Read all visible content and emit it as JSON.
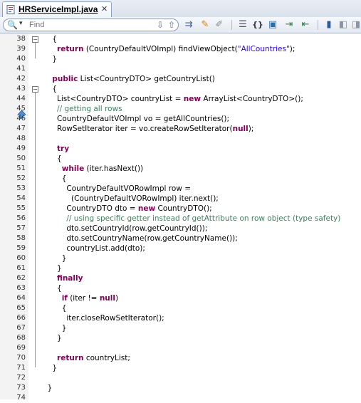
{
  "tab": {
    "title": "HRServiceImpl.java",
    "close": "✕"
  },
  "toolbar": {
    "find_placeholder": "Find",
    "icons": [
      "search-icon",
      "find-down-icon",
      "find-up-icon",
      "goto-icon",
      "highlight-icon",
      "clear-highlight-icon",
      "format-icon",
      "braces-icon",
      "toggle-comment-icon",
      "indent-icon",
      "unindent-icon",
      "bookmark-icon",
      "prev-bookmark-icon",
      "next-bookmark-icon"
    ]
  },
  "lines": [
    {
      "n": "38",
      "fold": "minus",
      "parts": [
        {
          "t": "    {"
        }
      ]
    },
    {
      "n": "39",
      "parts": [
        {
          "t": "      "
        },
        {
          "t": "return",
          "k": "kw"
        },
        {
          "t": " (CountryDefaultVOImpl) findViewObject("
        },
        {
          "t": "\"AllCountries\"",
          "k": "st"
        },
        {
          "t": ");"
        }
      ]
    },
    {
      "n": "40",
      "parts": [
        {
          "t": "    }"
        }
      ]
    },
    {
      "n": "41",
      "parts": [
        {
          "t": ""
        }
      ]
    },
    {
      "n": "42",
      "marker": true,
      "parts": [
        {
          "t": "    "
        },
        {
          "t": "public",
          "k": "kw"
        },
        {
          "t": " List<CountryDTO> getCountryList()"
        }
      ]
    },
    {
      "n": "43",
      "fold": "minus",
      "parts": [
        {
          "t": "    {"
        }
      ]
    },
    {
      "n": "44",
      "parts": [
        {
          "t": "      List<CountryDTO> countryList = "
        },
        {
          "t": "new",
          "k": "kw"
        },
        {
          "t": " ArrayList<CountryDTO>();"
        }
      ]
    },
    {
      "n": "45",
      "parts": [
        {
          "t": "      "
        },
        {
          "t": "// getting all rows",
          "k": "cm"
        }
      ]
    },
    {
      "n": "46",
      "parts": [
        {
          "t": "      CountryDefaultVOImpl vo = getAllCountries();"
        }
      ]
    },
    {
      "n": "47",
      "parts": [
        {
          "t": "      RowSetIterator iter = vo.createRowSetIterator("
        },
        {
          "t": "null",
          "k": "kw"
        },
        {
          "t": ");"
        }
      ]
    },
    {
      "n": "48",
      "parts": [
        {
          "t": ""
        }
      ]
    },
    {
      "n": "49",
      "parts": [
        {
          "t": "      "
        },
        {
          "t": "try",
          "k": "kw"
        }
      ]
    },
    {
      "n": "50",
      "parts": [
        {
          "t": "      {"
        }
      ]
    },
    {
      "n": "51",
      "parts": [
        {
          "t": "        "
        },
        {
          "t": "while",
          "k": "kw"
        },
        {
          "t": " (iter.hasNext())"
        }
      ]
    },
    {
      "n": "52",
      "parts": [
        {
          "t": "        {"
        }
      ]
    },
    {
      "n": "53",
      "parts": [
        {
          "t": "          CountryDefaultVORowImpl row ="
        }
      ]
    },
    {
      "n": "54",
      "parts": [
        {
          "t": "            (CountryDefaultVORowImpl) iter.next();"
        }
      ]
    },
    {
      "n": "55",
      "parts": [
        {
          "t": "          CountryDTO dto = "
        },
        {
          "t": "new",
          "k": "kw"
        },
        {
          "t": " CountryDTO();"
        }
      ]
    },
    {
      "n": "56",
      "parts": [
        {
          "t": "          "
        },
        {
          "t": "// using specific getter instead of getAttribute on row object (type safety)",
          "k": "cm"
        }
      ]
    },
    {
      "n": "57",
      "parts": [
        {
          "t": "          dto.setCountryId(row.getCountryId());"
        }
      ]
    },
    {
      "n": "58",
      "parts": [
        {
          "t": "          dto.setCountryName(row.getCountryName());"
        }
      ]
    },
    {
      "n": "59",
      "parts": [
        {
          "t": "          countryList.add(dto);"
        }
      ]
    },
    {
      "n": "60",
      "parts": [
        {
          "t": "        }"
        }
      ]
    },
    {
      "n": "61",
      "parts": [
        {
          "t": "      }"
        }
      ]
    },
    {
      "n": "62",
      "parts": [
        {
          "t": "      "
        },
        {
          "t": "finally",
          "k": "kw"
        }
      ]
    },
    {
      "n": "63",
      "parts": [
        {
          "t": "      {"
        }
      ]
    },
    {
      "n": "64",
      "parts": [
        {
          "t": "        "
        },
        {
          "t": "if",
          "k": "kw"
        },
        {
          "t": " (iter != "
        },
        {
          "t": "null",
          "k": "kw"
        },
        {
          "t": ")"
        }
      ]
    },
    {
      "n": "65",
      "parts": [
        {
          "t": "        {"
        }
      ]
    },
    {
      "n": "66",
      "parts": [
        {
          "t": "          iter.closeRowSetIterator();"
        }
      ]
    },
    {
      "n": "67",
      "parts": [
        {
          "t": "        }"
        }
      ]
    },
    {
      "n": "68",
      "parts": [
        {
          "t": "      }"
        }
      ]
    },
    {
      "n": "69",
      "parts": [
        {
          "t": ""
        }
      ]
    },
    {
      "n": "70",
      "parts": [
        {
          "t": "      "
        },
        {
          "t": "return",
          "k": "kw"
        },
        {
          "t": " countryList;"
        }
      ]
    },
    {
      "n": "71",
      "parts": [
        {
          "t": "    }"
        }
      ]
    },
    {
      "n": "72",
      "parts": [
        {
          "t": ""
        }
      ]
    },
    {
      "n": "73",
      "parts": [
        {
          "t": "  }"
        }
      ]
    },
    {
      "n": "74",
      "parts": [
        {
          "t": ""
        }
      ]
    }
  ]
}
